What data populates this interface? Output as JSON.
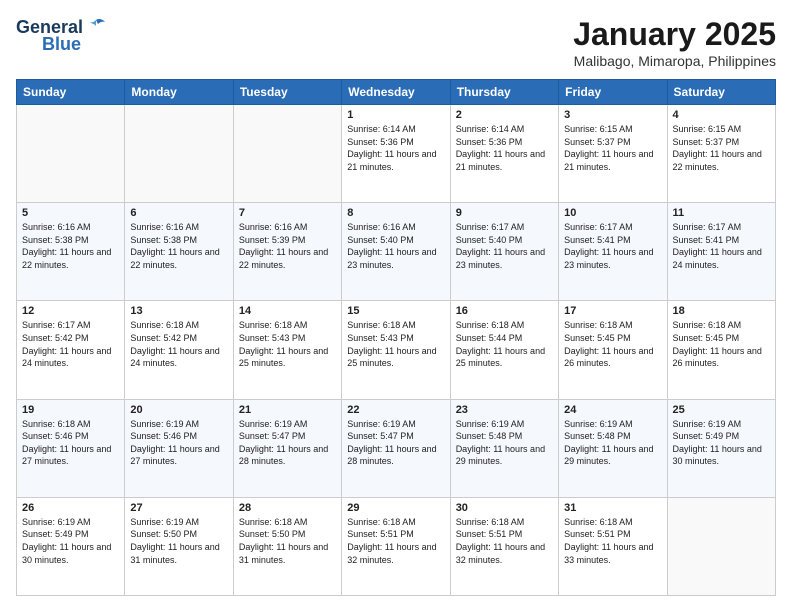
{
  "logo": {
    "line1": "General",
    "line2": "Blue"
  },
  "header": {
    "month": "January 2025",
    "location": "Malibago, Mimaropa, Philippines"
  },
  "weekdays": [
    "Sunday",
    "Monday",
    "Tuesday",
    "Wednesday",
    "Thursday",
    "Friday",
    "Saturday"
  ],
  "weeks": [
    [
      {
        "day": "",
        "sunrise": "",
        "sunset": "",
        "daylight": ""
      },
      {
        "day": "",
        "sunrise": "",
        "sunset": "",
        "daylight": ""
      },
      {
        "day": "",
        "sunrise": "",
        "sunset": "",
        "daylight": ""
      },
      {
        "day": "1",
        "sunrise": "6:14 AM",
        "sunset": "5:36 PM",
        "daylight": "11 hours and 21 minutes."
      },
      {
        "day": "2",
        "sunrise": "6:14 AM",
        "sunset": "5:36 PM",
        "daylight": "11 hours and 21 minutes."
      },
      {
        "day": "3",
        "sunrise": "6:15 AM",
        "sunset": "5:37 PM",
        "daylight": "11 hours and 21 minutes."
      },
      {
        "day": "4",
        "sunrise": "6:15 AM",
        "sunset": "5:37 PM",
        "daylight": "11 hours and 22 minutes."
      }
    ],
    [
      {
        "day": "5",
        "sunrise": "6:16 AM",
        "sunset": "5:38 PM",
        "daylight": "11 hours and 22 minutes."
      },
      {
        "day": "6",
        "sunrise": "6:16 AM",
        "sunset": "5:38 PM",
        "daylight": "11 hours and 22 minutes."
      },
      {
        "day": "7",
        "sunrise": "6:16 AM",
        "sunset": "5:39 PM",
        "daylight": "11 hours and 22 minutes."
      },
      {
        "day": "8",
        "sunrise": "6:16 AM",
        "sunset": "5:40 PM",
        "daylight": "11 hours and 23 minutes."
      },
      {
        "day": "9",
        "sunrise": "6:17 AM",
        "sunset": "5:40 PM",
        "daylight": "11 hours and 23 minutes."
      },
      {
        "day": "10",
        "sunrise": "6:17 AM",
        "sunset": "5:41 PM",
        "daylight": "11 hours and 23 minutes."
      },
      {
        "day": "11",
        "sunrise": "6:17 AM",
        "sunset": "5:41 PM",
        "daylight": "11 hours and 24 minutes."
      }
    ],
    [
      {
        "day": "12",
        "sunrise": "6:17 AM",
        "sunset": "5:42 PM",
        "daylight": "11 hours and 24 minutes."
      },
      {
        "day": "13",
        "sunrise": "6:18 AM",
        "sunset": "5:42 PM",
        "daylight": "11 hours and 24 minutes."
      },
      {
        "day": "14",
        "sunrise": "6:18 AM",
        "sunset": "5:43 PM",
        "daylight": "11 hours and 25 minutes."
      },
      {
        "day": "15",
        "sunrise": "6:18 AM",
        "sunset": "5:43 PM",
        "daylight": "11 hours and 25 minutes."
      },
      {
        "day": "16",
        "sunrise": "6:18 AM",
        "sunset": "5:44 PM",
        "daylight": "11 hours and 25 minutes."
      },
      {
        "day": "17",
        "sunrise": "6:18 AM",
        "sunset": "5:45 PM",
        "daylight": "11 hours and 26 minutes."
      },
      {
        "day": "18",
        "sunrise": "6:18 AM",
        "sunset": "5:45 PM",
        "daylight": "11 hours and 26 minutes."
      }
    ],
    [
      {
        "day": "19",
        "sunrise": "6:18 AM",
        "sunset": "5:46 PM",
        "daylight": "11 hours and 27 minutes."
      },
      {
        "day": "20",
        "sunrise": "6:19 AM",
        "sunset": "5:46 PM",
        "daylight": "11 hours and 27 minutes."
      },
      {
        "day": "21",
        "sunrise": "6:19 AM",
        "sunset": "5:47 PM",
        "daylight": "11 hours and 28 minutes."
      },
      {
        "day": "22",
        "sunrise": "6:19 AM",
        "sunset": "5:47 PM",
        "daylight": "11 hours and 28 minutes."
      },
      {
        "day": "23",
        "sunrise": "6:19 AM",
        "sunset": "5:48 PM",
        "daylight": "11 hours and 29 minutes."
      },
      {
        "day": "24",
        "sunrise": "6:19 AM",
        "sunset": "5:48 PM",
        "daylight": "11 hours and 29 minutes."
      },
      {
        "day": "25",
        "sunrise": "6:19 AM",
        "sunset": "5:49 PM",
        "daylight": "11 hours and 30 minutes."
      }
    ],
    [
      {
        "day": "26",
        "sunrise": "6:19 AM",
        "sunset": "5:49 PM",
        "daylight": "11 hours and 30 minutes."
      },
      {
        "day": "27",
        "sunrise": "6:19 AM",
        "sunset": "5:50 PM",
        "daylight": "11 hours and 31 minutes."
      },
      {
        "day": "28",
        "sunrise": "6:18 AM",
        "sunset": "5:50 PM",
        "daylight": "11 hours and 31 minutes."
      },
      {
        "day": "29",
        "sunrise": "6:18 AM",
        "sunset": "5:51 PM",
        "daylight": "11 hours and 32 minutes."
      },
      {
        "day": "30",
        "sunrise": "6:18 AM",
        "sunset": "5:51 PM",
        "daylight": "11 hours and 32 minutes."
      },
      {
        "day": "31",
        "sunrise": "6:18 AM",
        "sunset": "5:51 PM",
        "daylight": "11 hours and 33 minutes."
      },
      {
        "day": "",
        "sunrise": "",
        "sunset": "",
        "daylight": ""
      }
    ]
  ]
}
